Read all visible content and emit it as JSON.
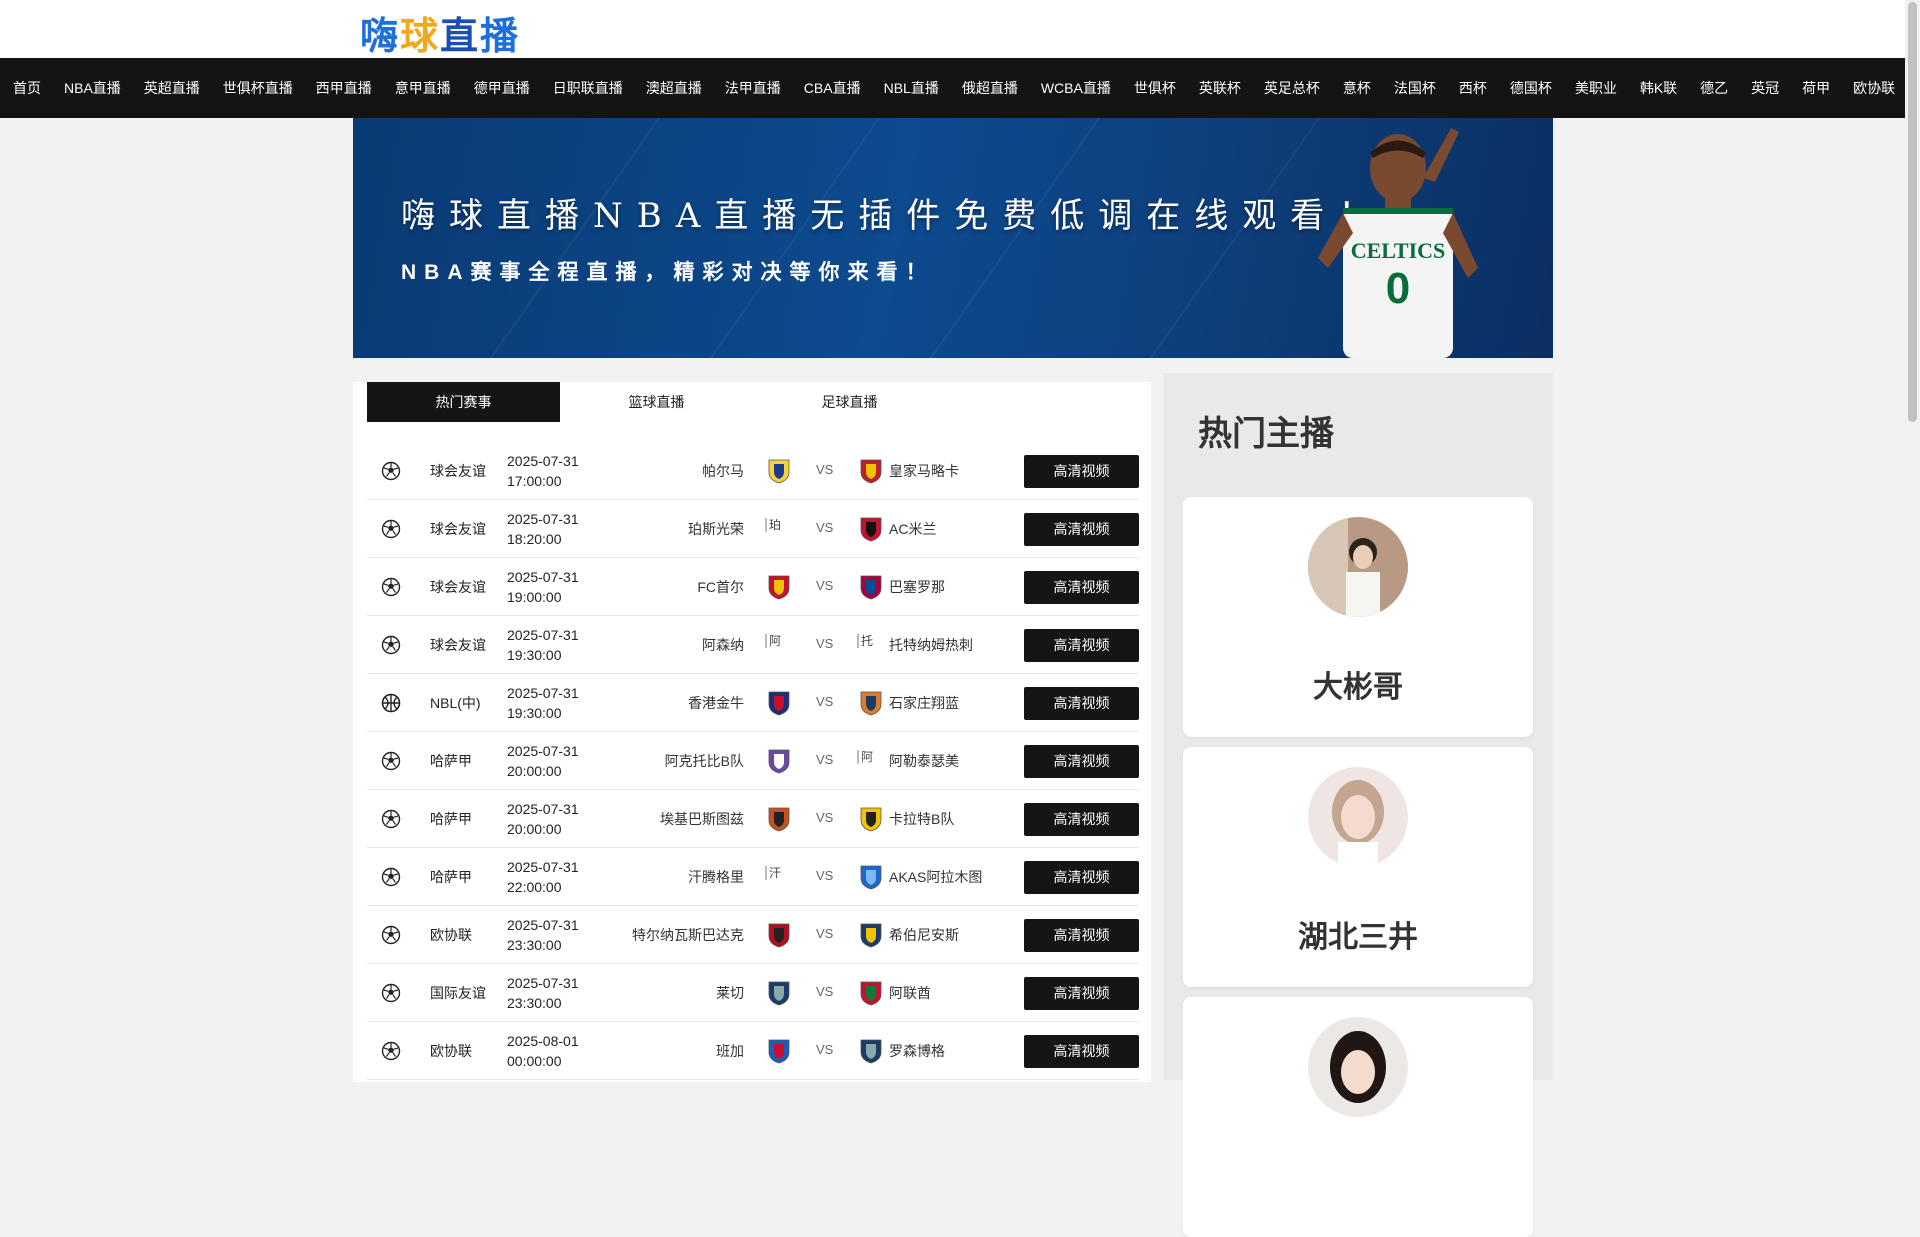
{
  "logo": {
    "chars": [
      "嗨",
      "球",
      "直",
      "播"
    ]
  },
  "nav": [
    "首页",
    "NBA直播",
    "英超直播",
    "世俱杯直播",
    "西甲直播",
    "意甲直播",
    "德甲直播",
    "日职联直播",
    "澳超直播",
    "法甲直播",
    "CBA直播",
    "NBL直播",
    "俄超直播",
    "WCBA直播",
    "世俱杯",
    "英联杯",
    "英足总杯",
    "意杯",
    "法国杯",
    "西杯",
    "德国杯",
    "美职业",
    "韩K联",
    "德乙",
    "英冠",
    "荷甲",
    "欧协联"
  ],
  "banner": {
    "title": "嗨球直播NBA直播无插件免费低调在线观看！",
    "subtitle": "NBA赛事全程直播，精彩对决等你来看！",
    "jersey_text": "CELTICS",
    "jersey_number": "0"
  },
  "tabs": [
    "热门赛事",
    "篮球直播",
    "足球直播"
  ],
  "matches": [
    {
      "sport": "soccer",
      "league": "球会友谊",
      "date": "2025-07-31",
      "time": "17:00:00",
      "home": "帕尔马",
      "away": "皇家马略卡",
      "home_logo_alt": "",
      "away_logo_alt": "",
      "button": "高清视频"
    },
    {
      "sport": "soccer",
      "league": "球会友谊",
      "date": "2025-07-31",
      "time": "18:20:00",
      "home": "珀斯光荣",
      "away": "AC米兰",
      "home_logo_alt": "珀",
      "away_logo_alt": "",
      "button": "高清视频"
    },
    {
      "sport": "soccer",
      "league": "球会友谊",
      "date": "2025-07-31",
      "time": "19:00:00",
      "home": "FC首尔",
      "away": "巴塞罗那",
      "home_logo_alt": "",
      "away_logo_alt": "",
      "button": "高清视频"
    },
    {
      "sport": "soccer",
      "league": "球会友谊",
      "date": "2025-07-31",
      "time": "19:30:00",
      "home": "阿森纳",
      "away": "托特纳姆热刺",
      "home_logo_alt": "阿",
      "away_logo_alt": "托",
      "button": "高清视频"
    },
    {
      "sport": "basketball",
      "league": "NBL(中)",
      "date": "2025-07-31",
      "time": "19:30:00",
      "home": "香港金牛",
      "away": "石家庄翔蓝",
      "home_logo_alt": "",
      "away_logo_alt": "",
      "button": "高清视频"
    },
    {
      "sport": "soccer",
      "league": "哈萨甲",
      "date": "2025-07-31",
      "time": "20:00:00",
      "home": "阿克托比B队",
      "away": "阿勒泰瑟美",
      "home_logo_alt": "",
      "away_logo_alt": "阿",
      "button": "高清视频"
    },
    {
      "sport": "soccer",
      "league": "哈萨甲",
      "date": "2025-07-31",
      "time": "20:00:00",
      "home": "埃基巴斯图兹",
      "away": "卡拉特B队",
      "home_logo_alt": "",
      "away_logo_alt": "",
      "button": "高清视频"
    },
    {
      "sport": "soccer",
      "league": "哈萨甲",
      "date": "2025-07-31",
      "time": "22:00:00",
      "home": "汗腾格里",
      "away": "AKAS阿拉木图",
      "home_logo_alt": "汗",
      "away_logo_alt": "",
      "button": "高清视频"
    },
    {
      "sport": "soccer",
      "league": "欧协联",
      "date": "2025-07-31",
      "time": "23:30:00",
      "home": "特尔纳瓦斯巴达克",
      "away": "希伯尼安斯",
      "home_logo_alt": "",
      "away_logo_alt": "",
      "button": "高清视频"
    },
    {
      "sport": "soccer",
      "league": "国际友谊",
      "date": "2025-07-31",
      "time": "23:30:00",
      "home": "莱切",
      "away": "阿联酋",
      "home_logo_alt": "",
      "away_logo_alt": "",
      "button": "高清视频"
    },
    {
      "sport": "soccer",
      "league": "欧协联",
      "date": "2025-08-01",
      "time": "00:00:00",
      "home": "班加",
      "away": "罗森博格",
      "home_logo_alt": "",
      "away_logo_alt": "",
      "button": "高清视频"
    }
  ],
  "side": {
    "title": "热门主播",
    "anchors": [
      {
        "name": "大彬哥"
      },
      {
        "name": "湖北三井"
      },
      {
        "name": ""
      }
    ]
  },
  "colors": {
    "nav_bg": "#141414",
    "button_bg": "#151515",
    "banner_bg": "#0d4a8e"
  }
}
